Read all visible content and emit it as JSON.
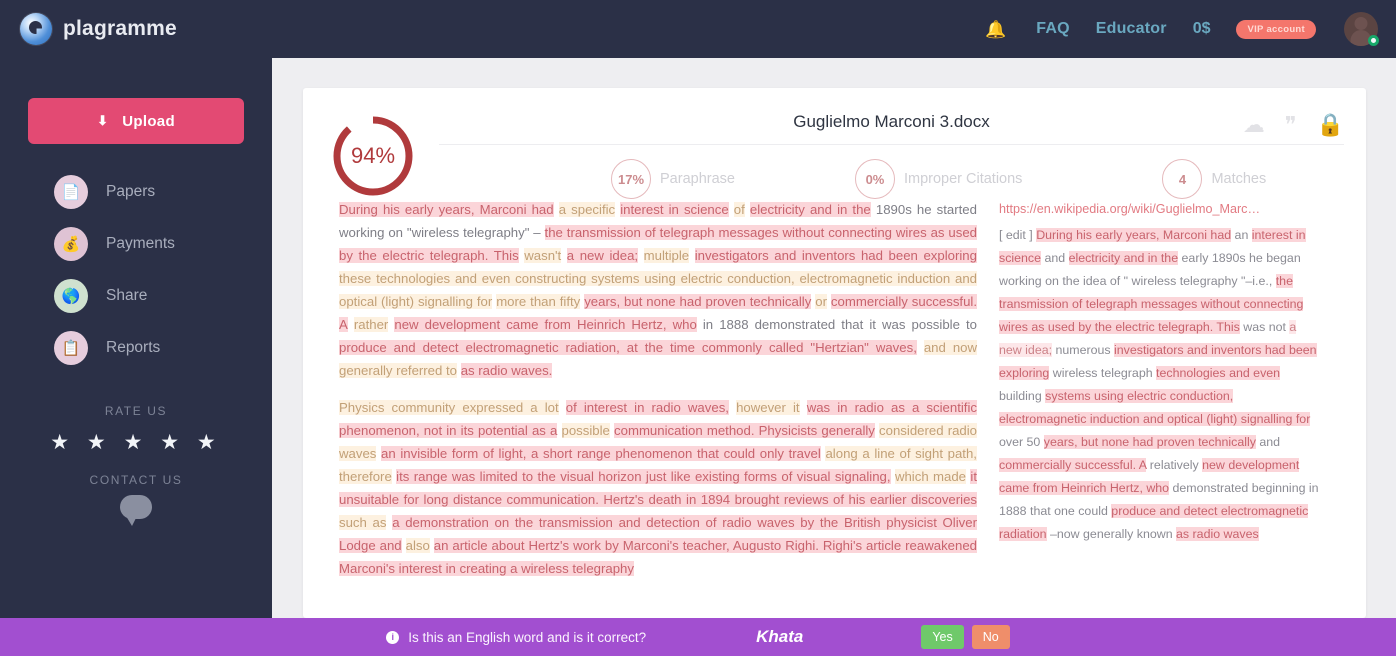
{
  "brand": {
    "name": "plagramme",
    "logo_icon": "plagramme-logo-icon"
  },
  "topnav": {
    "bell_icon": "notification-bell-icon",
    "faq": "FAQ",
    "educator": "Educator",
    "balance": "0$",
    "vip_badge": "VIP account",
    "avatar_icon": "user-avatar-icon"
  },
  "sidebar": {
    "upload_label": "Upload",
    "upload_icon": "upload-icon",
    "items": [
      {
        "label": "Papers",
        "icon": "papers-icon"
      },
      {
        "label": "Payments",
        "icon": "money-bag-icon"
      },
      {
        "label": "Share",
        "icon": "globe-share-icon"
      },
      {
        "label": "Reports",
        "icon": "report-search-icon"
      }
    ],
    "rate_us": "RATE US",
    "stars": "★ ★ ★ ★ ★",
    "contact_us": "CONTACT US",
    "chat_icon": "chat-bubble-icon"
  },
  "document": {
    "title": "Guglielmo Marconi 3.docx",
    "score": "94%",
    "score_value": 94,
    "stats": [
      {
        "value": "17%",
        "label": "Paraphrase"
      },
      {
        "value": "0%",
        "label": "Improper Citations"
      },
      {
        "value": "4",
        "label": "Matches"
      }
    ],
    "actions": [
      {
        "icon": "cloud-download-icon"
      },
      {
        "icon": "quote-icon"
      },
      {
        "icon": "lock-icon"
      }
    ]
  },
  "source": {
    "url": "https://en.wikipedia.org/wiki/Guglielmo_Marc…"
  },
  "bottombar": {
    "info_icon": "info-icon",
    "question": "Is this an English word and is it correct?",
    "word": "Khata",
    "yes_label": "Yes",
    "no_label": "No"
  },
  "colors": {
    "sidebar_bg": "#2b3047",
    "accent_pink": "#e34a73",
    "link_teal": "#6aa8c0",
    "vip_red": "#f4766c",
    "gauge_red": "#b03a3c",
    "bottom_purple": "#a24fd0",
    "yes_green": "#6fc96a",
    "no_orange": "#ef8e6a"
  }
}
